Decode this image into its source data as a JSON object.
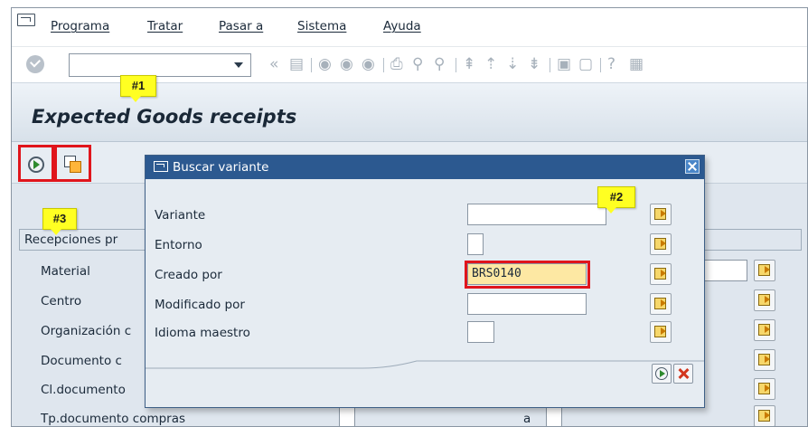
{
  "menu": {
    "items": [
      "Programa",
      "Tratar",
      "Pasar a",
      "Sistema",
      "Ayuda"
    ]
  },
  "toolbar": {
    "command_value": "",
    "icons": [
      "back-icon",
      "save-icon",
      "nav-back-icon",
      "exit-icon",
      "cancel-icon",
      "print-icon",
      "find-icon",
      "find-next-icon",
      "first-page-icon",
      "prev-page-icon",
      "next-page-icon",
      "last-page-icon",
      "new-session-icon",
      "shortcut-icon",
      "help-icon",
      "layout-icon"
    ]
  },
  "page": {
    "title": "Expected Goods receipts"
  },
  "callouts": {
    "c1": "#1",
    "c2": "#2",
    "c3": "#3"
  },
  "selection": {
    "group_title": "Recepciones pr",
    "fields": [
      {
        "label": "Material"
      },
      {
        "label": "Centro"
      },
      {
        "label": "Organización c"
      },
      {
        "label": "Documento c"
      },
      {
        "label": "Cl.documento"
      },
      {
        "label": "Tp.documento compras"
      }
    ],
    "to_label": "a"
  },
  "dialog": {
    "title": "Buscar variante",
    "fields": [
      {
        "label": "Variante",
        "value": ""
      },
      {
        "label": "Entorno",
        "value": ""
      },
      {
        "label": "Creado por",
        "value": "BRS0140"
      },
      {
        "label": "Modificado por",
        "value": ""
      },
      {
        "label": "Idioma maestro",
        "value": ""
      }
    ]
  },
  "colors": {
    "highlight": "#e0151c",
    "dialog_header": "#2c5990",
    "callout": "#ffff22",
    "active_input": "#fde8a3"
  }
}
